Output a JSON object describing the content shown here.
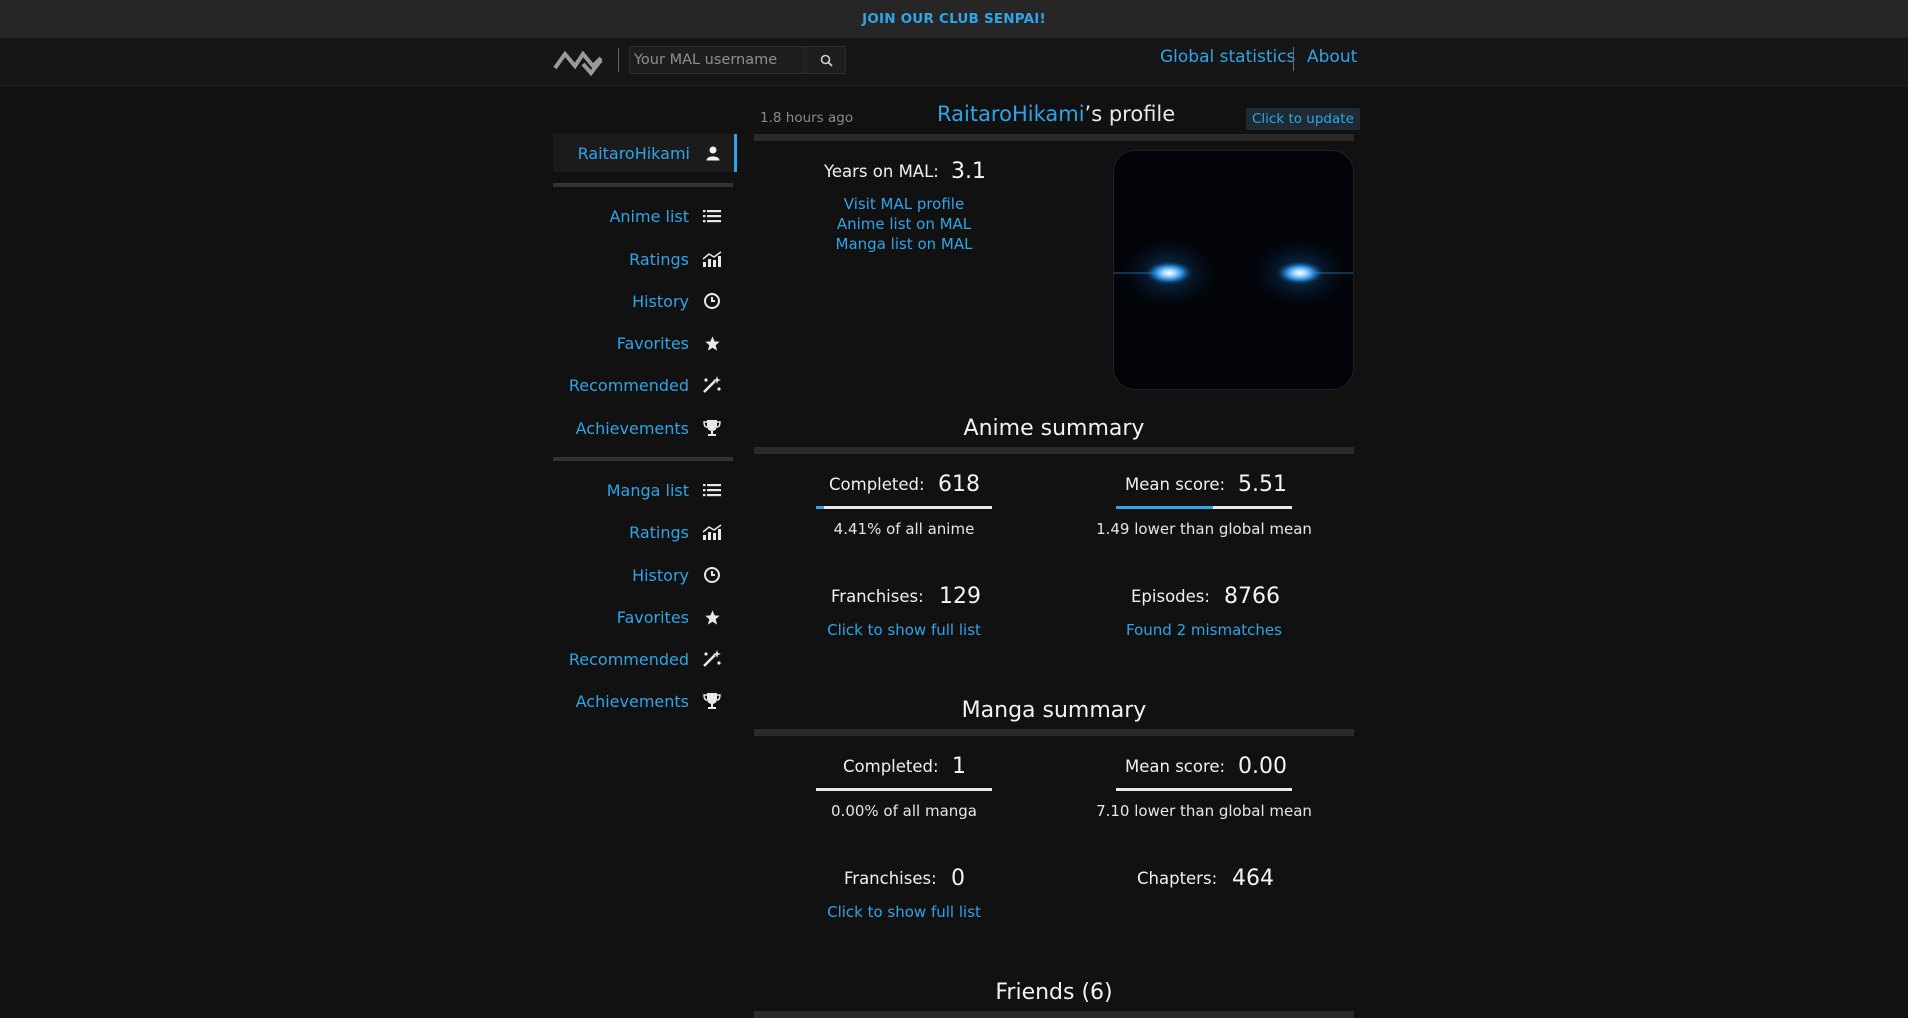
{
  "banner": {
    "text": "JOIN OUR CLUB SENPAI!"
  },
  "header": {
    "search_placeholder": "Your MAL username",
    "links": [
      "Global statistics",
      "About"
    ]
  },
  "sidebar": {
    "username": "RaitaroHikami",
    "anime_items": [
      "Anime list",
      "Ratings",
      "History",
      "Favorites",
      "Recommended",
      "Achievements"
    ],
    "manga_items": [
      "Manga list",
      "Ratings",
      "History",
      "Favorites",
      "Recommended",
      "Achievements"
    ]
  },
  "profile": {
    "updated_ago": "1.8 hours ago",
    "username": "RaitaroHikami",
    "title_suffix": "’s profile",
    "update_button": "Click to update",
    "years_label": "Years on MAL:",
    "years_value": "3.1",
    "links": [
      "Visit MAL profile",
      "Anime list on MAL",
      "Manga list on MAL"
    ]
  },
  "anime_summary": {
    "title": "Anime summary",
    "completed_label": "Completed:",
    "completed_value": "618",
    "completed_fraction": 0.0441,
    "completed_sub": "4.41% of all anime",
    "mean_label": "Mean score:",
    "mean_value": "5.51",
    "mean_fraction": 0.551,
    "mean_sub": "1.49 lower than global mean",
    "franchises_label": "Franchises:",
    "franchises_value": "129",
    "franchises_link": "Click to show full list",
    "episodes_label": "Episodes:",
    "episodes_value": "8766",
    "episodes_link": "Found 2 mismatches"
  },
  "manga_summary": {
    "title": "Manga summary",
    "completed_label": "Completed:",
    "completed_value": "1",
    "completed_fraction": 0,
    "completed_sub": "0.00% of all manga",
    "mean_label": "Mean score:",
    "mean_value": "0.00",
    "mean_fraction": 0,
    "mean_sub": "7.10 lower than global mean",
    "franchises_label": "Franchises:",
    "franchises_value": "0",
    "franchises_link": "Click to show full list",
    "chapters_label": "Chapters:",
    "chapters_value": "464"
  },
  "friends": {
    "title": "Friends (6)"
  },
  "colors": {
    "accent": "#2fa4e7",
    "background": "#111111",
    "banner": "#262626"
  }
}
